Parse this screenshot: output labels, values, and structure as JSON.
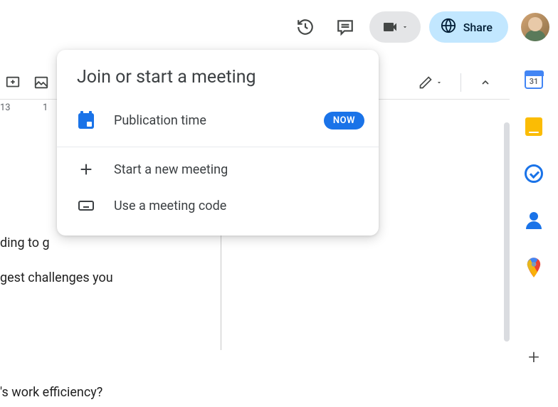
{
  "toolbar": {
    "share_label": "Share"
  },
  "ruler": {
    "tick13": "13",
    "tick1": "1"
  },
  "calendar_day": "31",
  "doc": {
    "line1": "ding to g",
    "line2": "gest challenges you",
    "line3": "'s work efficiency?"
  },
  "popover": {
    "title": "Join or start a meeting",
    "meeting_label": "Publication time",
    "now_badge": "NOW",
    "start_label": "Start a new meeting",
    "code_label": "Use a meeting code"
  }
}
